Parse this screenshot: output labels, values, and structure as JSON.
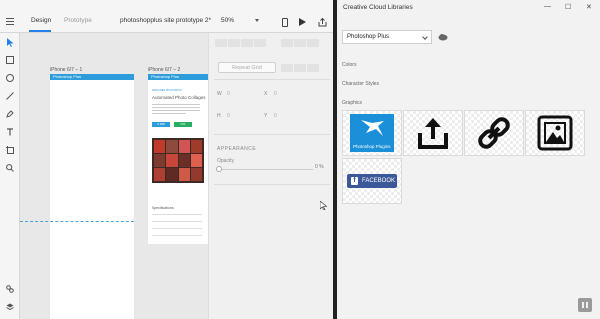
{
  "xd": {
    "tabs": [
      {
        "label": "Design"
      },
      {
        "label": "Prototype"
      }
    ],
    "doc_title": "photoshopplus site prototype 2*",
    "zoom": "50%",
    "artboards": [
      {
        "label": "iPhone 6/7 – 1",
        "header": "Photoshop Plus"
      },
      {
        "label": "iPhone 6/7 – 2",
        "header": "Photoshop Plus"
      }
    ],
    "artboard2": {
      "tag": "NEW FREE PHOTOSHOP",
      "heading": "Automated Photo Collages",
      "btn1": "0.99$",
      "btn2": "FW",
      "specs_title": "Specifications"
    },
    "props": {
      "repeat_grid": "Repeat Grid",
      "w_label": "W",
      "w_val": "0",
      "x_label": "X",
      "x_val": "0",
      "h_label": "H",
      "h_val": "0",
      "y_label": "Y",
      "y_val": "0",
      "appearance": "APPEARANCE",
      "opacity_label": "Opacity",
      "opacity_val": "0 %",
      "opacity_level": 0
    }
  },
  "cc": {
    "title": "Creative Cloud Libraries",
    "library": "Photoshop Plus",
    "sections": {
      "colors": "Colors",
      "char_styles": "Character Styles",
      "graphics": "Graphics"
    },
    "graphics": [
      {
        "name": "photoshop-plus-logo",
        "text": "Photoshop Plugins"
      },
      {
        "name": "share-icon"
      },
      {
        "name": "link-icon"
      },
      {
        "name": "image-icon"
      },
      {
        "name": "facebook-button",
        "text": "FACEBOOK"
      }
    ]
  }
}
